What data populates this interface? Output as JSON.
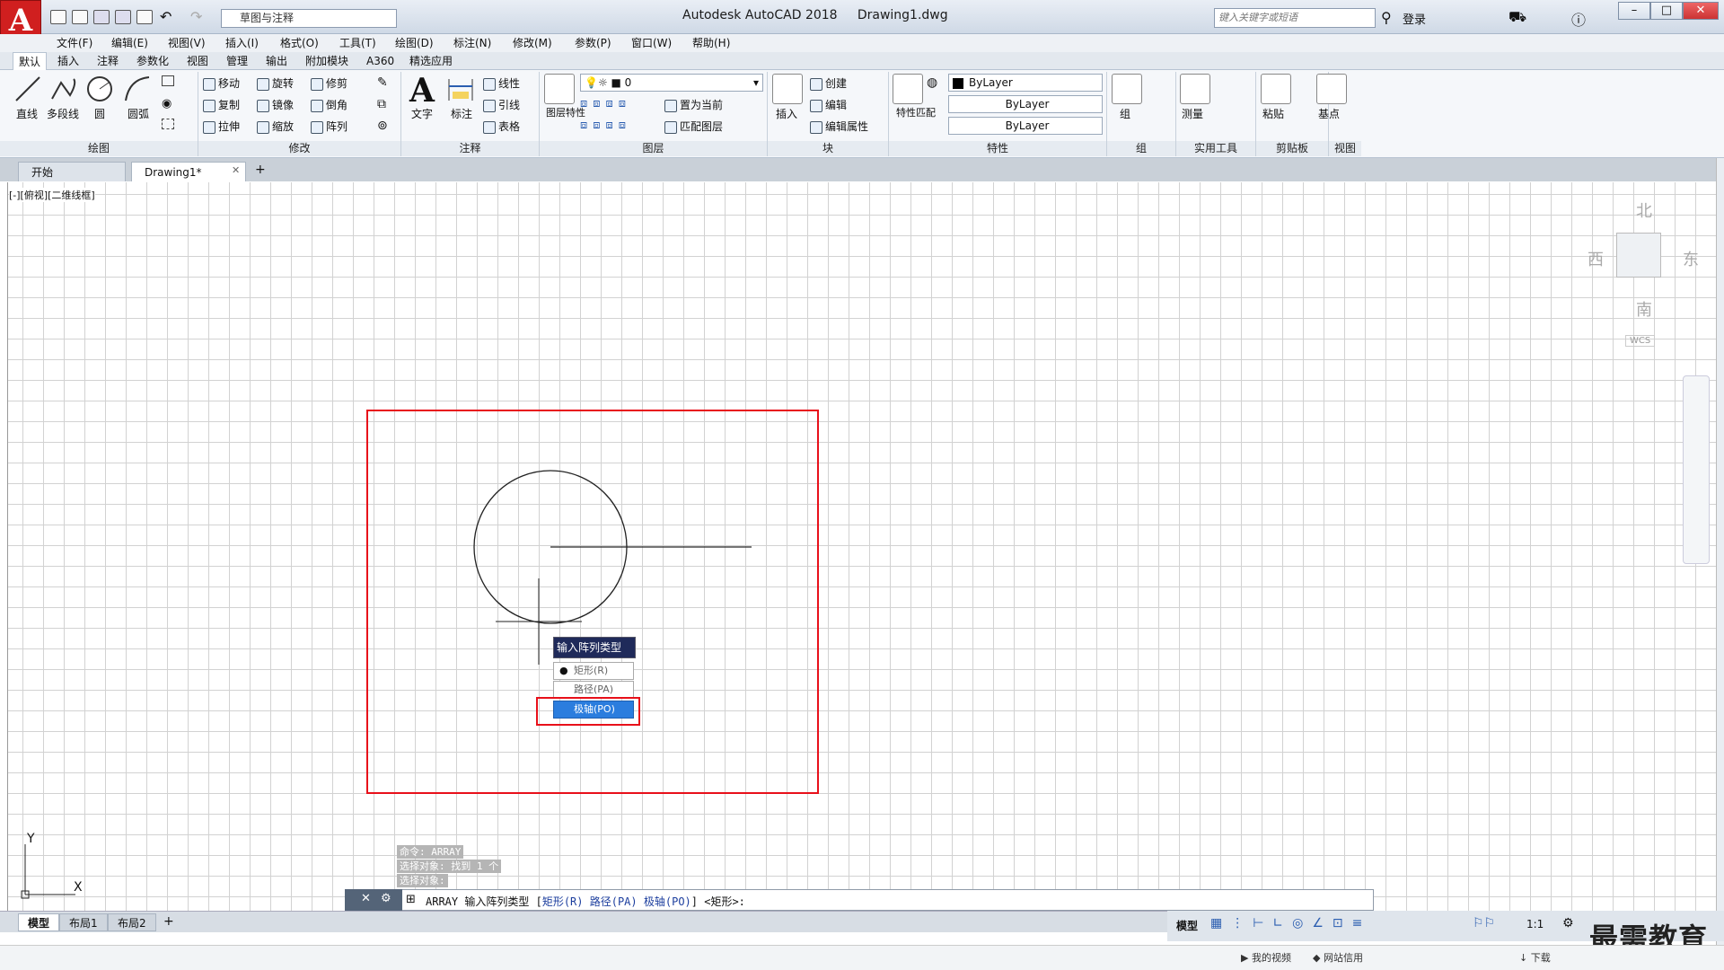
{
  "title_bar": {
    "app_title": "Autodesk AutoCAD 2018",
    "doc_title": "Drawing1.dwg",
    "workspace": "草图与注释",
    "search_placeholder": "键入关键字或短语",
    "login": "登录"
  },
  "menu": [
    "文件(F)",
    "编辑(E)",
    "视图(V)",
    "插入(I)",
    "格式(O)",
    "工具(T)",
    "绘图(D)",
    "标注(N)",
    "修改(M)",
    "参数(P)",
    "窗口(W)",
    "帮助(H)"
  ],
  "ribbon_tabs": [
    "默认",
    "插入",
    "注释",
    "参数化",
    "视图",
    "管理",
    "输出",
    "附加模块",
    "A360",
    "精选应用"
  ],
  "ribbon": {
    "draw": {
      "line": "直线",
      "polyline": "多段线",
      "circle": "圆",
      "arc": "圆弧",
      "panel": "绘图"
    },
    "modify": {
      "move": "移动",
      "rotate": "旋转",
      "trim": "修剪",
      "copy": "复制",
      "mirror": "镜像",
      "fillet": "倒角",
      "stretch": "拉伸",
      "scale": "缩放",
      "array": "阵列",
      "panel": "修改"
    },
    "annotation": {
      "text": "文字",
      "dim": "标注",
      "linear": "线性",
      "leader": "引线",
      "table": "表格",
      "panel": "注释"
    },
    "layers": {
      "props": "图层特性",
      "current_layer": "0",
      "set_current": "置为当前",
      "match": "匹配图层",
      "panel": "图层"
    },
    "block": {
      "insert": "插入",
      "create": "创建",
      "edit": "编辑",
      "edit_attr": "编辑属性",
      "panel": "块"
    },
    "properties": {
      "match": "特性匹配",
      "color": "ByLayer",
      "linetype": "ByLayer",
      "lineweight": "ByLayer",
      "panel": "特性"
    },
    "groups": {
      "group": "组",
      "panel": "组"
    },
    "utilities": {
      "measure": "测量",
      "panel": "实用工具"
    },
    "clipboard": {
      "paste": "粘贴",
      "panel": "剪贴板"
    },
    "view": {
      "base": "基点",
      "panel": "视图"
    }
  },
  "doc_tabs": {
    "start": "开始",
    "drawing": "Drawing1*"
  },
  "viewport_label": "[-][俯视][二维线框]",
  "viewcube": {
    "north": "北",
    "south": "南",
    "east": "东",
    "west": "西",
    "wcs": "WCS"
  },
  "ucs": {
    "x": "X",
    "y": "Y"
  },
  "tooltip": "输入阵列类型",
  "context_menu": [
    {
      "label": "矩形(R)",
      "checked": true
    },
    {
      "label": "路径(PA)",
      "checked": false
    },
    {
      "label": "极轴(PO)",
      "checked": false,
      "selected": true
    }
  ],
  "command_history": [
    "命令: ARRAY",
    "选择对象: 找到 1 个",
    "选择对象:"
  ],
  "command_line": {
    "cmd": "ARRAY",
    "prompt": "输入阵列类型 [",
    "opt1": "矩形(R)",
    "opt2": "路径(PA)",
    "opt3": "极轴(PO)",
    "tail": "] <矩形>:"
  },
  "layout_tabs": [
    "模型",
    "布局1",
    "布局2"
  ],
  "status": {
    "model": "模型",
    "scale": "1:1"
  },
  "taskbar": {
    "video": "我的视频",
    "netcredit": "网站信用",
    "download": "下载"
  },
  "watermark": "最需教育"
}
